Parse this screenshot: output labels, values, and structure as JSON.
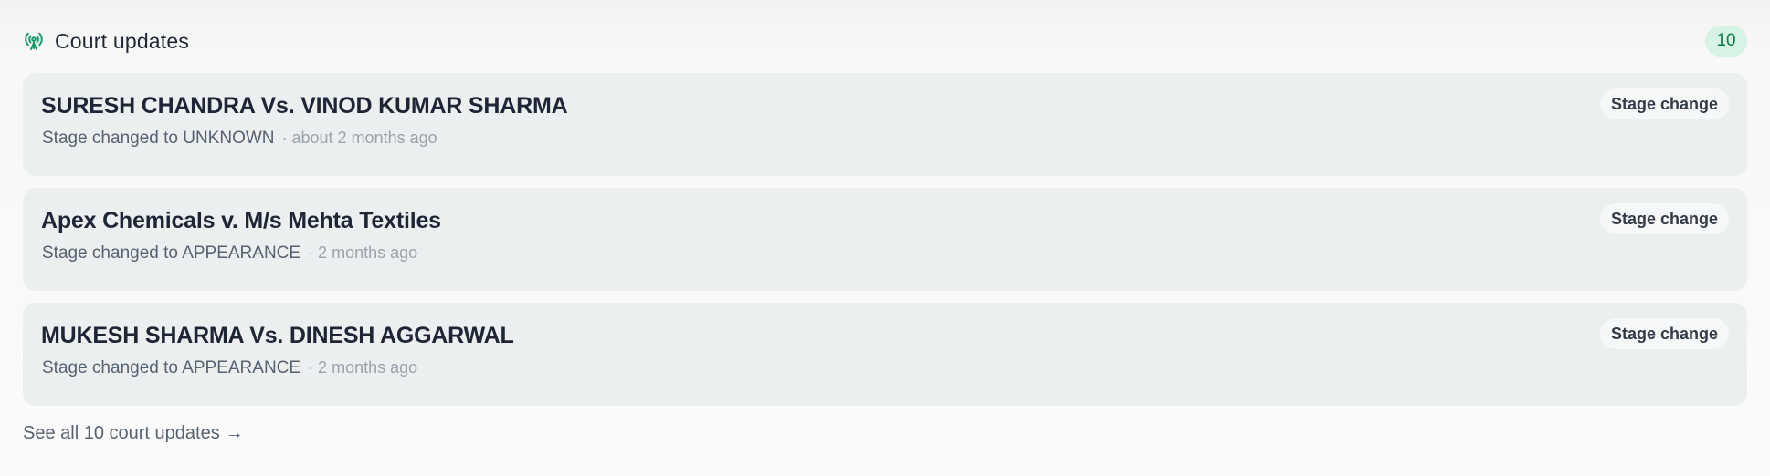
{
  "header": {
    "title": "Court updates",
    "icon": "broadcast-tower-icon",
    "count": "10"
  },
  "updates": [
    {
      "title": "SURESH CHANDRA Vs. VINOD KUMAR SHARMA",
      "meta": "Stage changed to UNKNOWN",
      "time": "· about 2 months ago",
      "tag": "Stage change"
    },
    {
      "title": "Apex Chemicals v. M/s Mehta Textiles",
      "meta": "Stage changed to APPEARANCE",
      "time": "· 2 months ago",
      "tag": "Stage change"
    },
    {
      "title": "MUKESH SHARMA Vs. DINESH AGGARWAL",
      "meta": "Stage changed to APPEARANCE",
      "time": "· 2 months ago",
      "tag": "Stage change"
    }
  ],
  "footer": {
    "see_all_label": "See all 10 court updates",
    "arrow": "→"
  },
  "colors": {
    "accent": "#0d7a4d",
    "badge_bg": "#d7f3e3",
    "card_bg": "#eceff0"
  }
}
